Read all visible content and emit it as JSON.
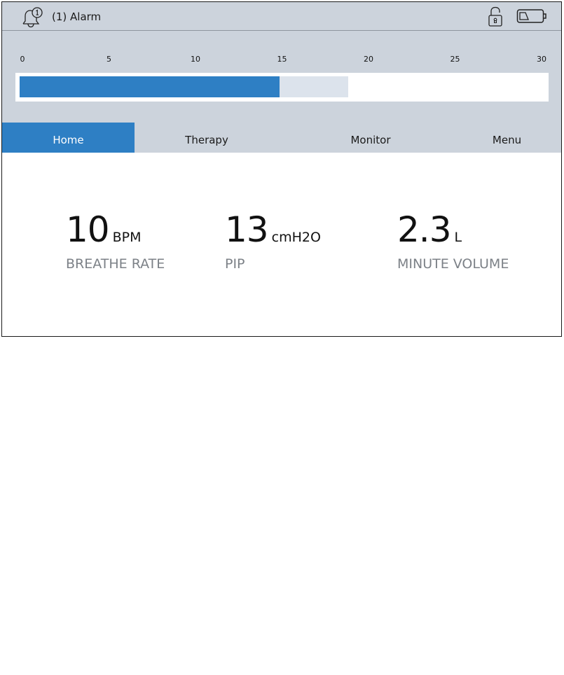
{
  "status_bar": {
    "alarm_icon": "bell-with-clock-icon",
    "alarm_label": "(1) Alarm",
    "lock_icon": "unlocked-padlock-icon",
    "battery_icon": "battery-low-icon",
    "battery_level": 0.25
  },
  "gauge": {
    "ticks": [
      "0",
      "5",
      "10",
      "15",
      "20",
      "25",
      "30"
    ],
    "min": 0,
    "max": 30,
    "current_value": 15,
    "range_end": 19,
    "fill_color": "#2e7fc4",
    "range_color": "#dce3ec"
  },
  "tabs": [
    {
      "label": "Home",
      "active": true
    },
    {
      "label": "Therapy",
      "active": false
    },
    {
      "label": "Monitor",
      "active": false
    },
    {
      "label": "Menu",
      "active": false
    }
  ],
  "metrics": [
    {
      "value": "10",
      "unit": "BPM",
      "label": "BREATHE RATE"
    },
    {
      "value": "13",
      "unit": "cmH2O",
      "label": "PIP"
    },
    {
      "value": "2.3",
      "unit": "L",
      "label": "MINUTE VOLUME"
    }
  ],
  "colors": {
    "accent": "#2e7fc4",
    "bar_background": "#ccd3dc",
    "label_gray": "#7c8187"
  }
}
